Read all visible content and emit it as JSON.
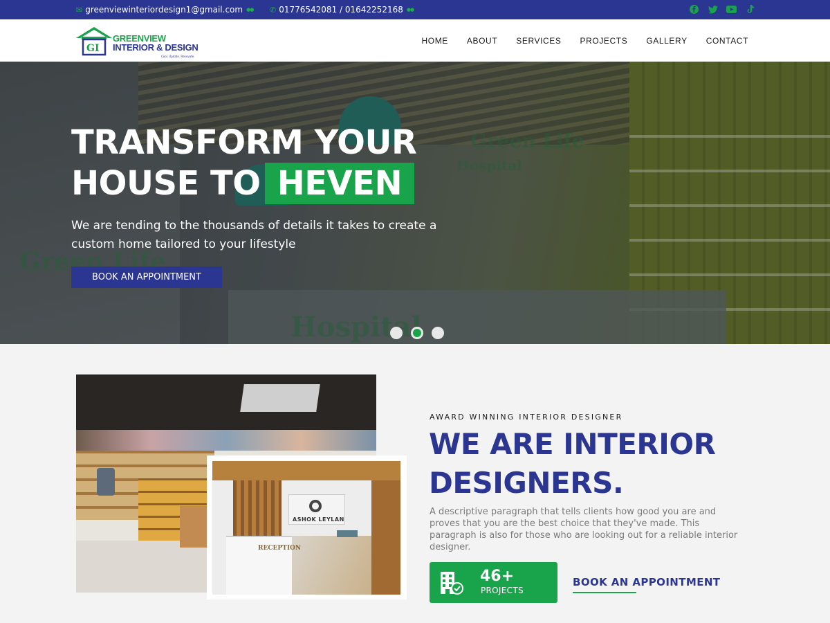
{
  "topbar": {
    "email": "greenviewinteriordesign1@gmail.com",
    "phone": "01776542081 / 01642252168",
    "social_icons": [
      "facebook-icon",
      "twitter-icon",
      "youtube-icon",
      "tiktok-icon"
    ]
  },
  "brand": {
    "line1": "GREENVIEW",
    "line2": "INTERIOR & DESIGN",
    "monogram": "GI",
    "tagline": "Cool. Update. Renovate."
  },
  "nav": {
    "items": [
      "HOME",
      "ABOUT",
      "SERVICES",
      "PROJECTS",
      "GALLERY",
      "CONTACT"
    ]
  },
  "hero": {
    "title_line1": "TRANSFORM YOUR",
    "title_line2": "HOUSE TO",
    "title_highlight": "HEVEN",
    "subtitle": "We are tending to the thousands of details it takes to create a custom home tailored to your lifestyle",
    "button_label": "BOOK AN APPOINTMENT",
    "slide_count": 3,
    "active_slide": 2,
    "bg_text": {
      "t1": "Green Life",
      "t2": "Hospital",
      "t3": "Green Life",
      "t4": "Hospital"
    }
  },
  "about": {
    "eyebrow": "AWARD WINNING INTERIOR DESIGNER",
    "title": "WE ARE INTERIOR DESIGNERS.",
    "description": "A descriptive paragraph that tells clients how good you are and proves that you are the best choice that they've made. This paragraph is also for those who are looking out for a reliable interior designer.",
    "projects_count": "46+",
    "projects_label": "PROJECTS",
    "book_link": "BOOK AN APPOINTMENT",
    "image_texts": {
      "sign": "ASHOK LEYLAN",
      "desk": "RECEPTION"
    }
  },
  "colors": {
    "primary_blue": "#2b3592",
    "accent_green": "#19a34a"
  }
}
